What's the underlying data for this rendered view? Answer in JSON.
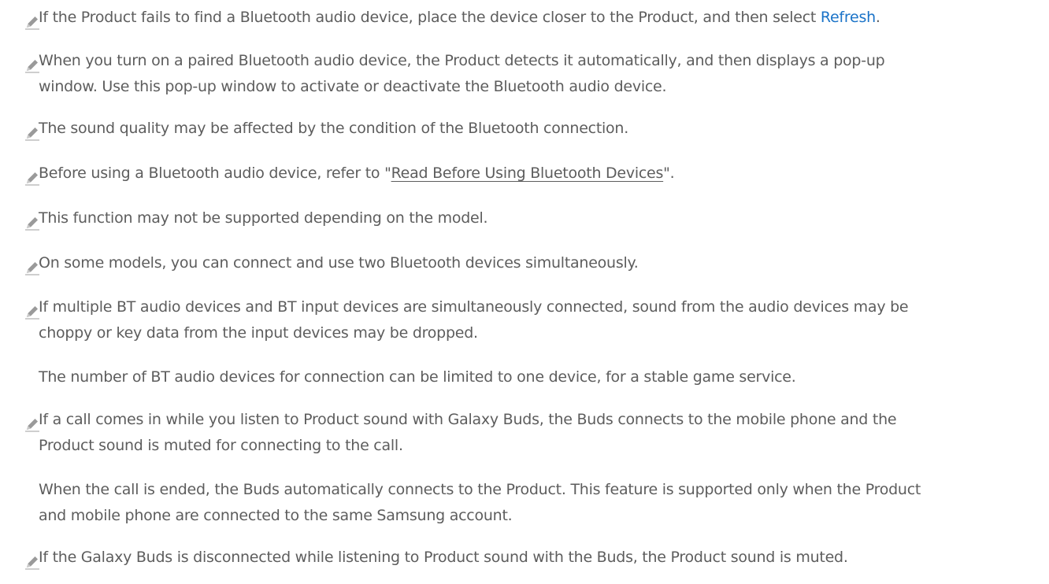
{
  "notes": [
    {
      "before": "If the Product fails to find a Bluetooth audio device, place the device closer to the Product, and then select ",
      "link": "Refresh",
      "after": "."
    },
    {
      "line1": "When you turn on a paired Bluetooth audio device, the Product detects it automatically, and then displays a pop-up",
      "line2": "window. Use this pop-up window to activate or deactivate the Bluetooth audio device."
    },
    {
      "text": "The sound quality may be affected by the condition of the Bluetooth connection."
    },
    {
      "before": "Before using a Bluetooth audio device, refer to \"",
      "link": "Read Before Using Bluetooth Devices",
      "after": "\"."
    },
    {
      "text": "This function may not be supported depending on the model."
    },
    {
      "text": "On some models, you can connect and use two Bluetooth devices simultaneously."
    },
    {
      "line1": "If multiple BT audio devices and BT input devices are simultaneously connected, sound from the audio devices may be",
      "line2": "choppy or key data from the input devices may be dropped.",
      "extra": "The number of BT audio devices for connection can be limited to one device, for a stable game service."
    },
    {
      "line1": "If a call comes in while you listen to Product sound with Galaxy Buds, the Buds connects to the mobile phone and the",
      "line2": "Product sound is muted for connecting to the call.",
      "extra1": "When the call is ended, the Buds automatically connects to the Product. This feature is supported only when the Product",
      "extra2": "and mobile phone are connected to the same Samsung account."
    },
    {
      "text": "If the Galaxy Buds is disconnected while listening to Product sound with the Buds, the Product sound is muted."
    }
  ],
  "icon": "pencil-note-icon",
  "colors": {
    "text": "#5d5d5d",
    "link": "#1a73c8",
    "icon": "#8c8c8c"
  }
}
